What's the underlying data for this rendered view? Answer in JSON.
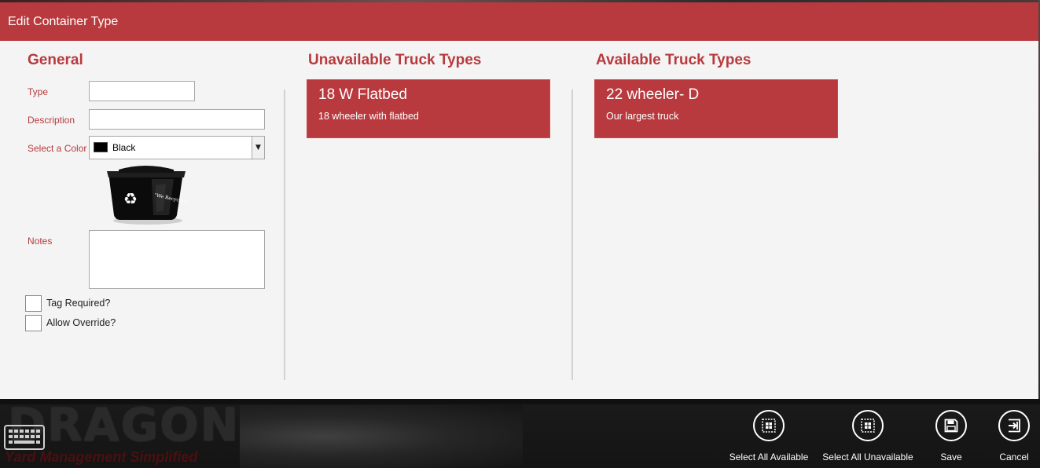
{
  "window": {
    "title": "Edit Container Type"
  },
  "general": {
    "heading": "General",
    "type_label": "Type",
    "type_value": "",
    "description_label": "Description",
    "description_value": "",
    "color_label": "Select a Color",
    "color_value": "Black",
    "color_swatch": "#000000",
    "notes_label": "Notes",
    "notes_value": "",
    "bin_image_text": "\"We Recycle!\"",
    "tag_required_label": "Tag Required?",
    "tag_required_checked": false,
    "allow_override_label": "Allow Override?",
    "allow_override_checked": false
  },
  "unavailable": {
    "heading": "Unavailable Truck Types",
    "items": [
      {
        "name": "18 W Flatbed",
        "description": "18 wheeler with flatbed"
      }
    ]
  },
  "available": {
    "heading": "Available Truck Types",
    "items": [
      {
        "name": "22 wheeler- D",
        "description": "Our largest truck"
      }
    ]
  },
  "appbar": {
    "brand_name": "DRAGON",
    "brand_tagline": "Yard Management Simplified",
    "select_all_available": "Select All Available",
    "select_all_unavailable": "Select All Unavailable",
    "save": "Save",
    "cancel": "Cancel"
  },
  "colors": {
    "accent": "#b83a3e",
    "panel": "#f4f4f4",
    "appbar": "#141414"
  }
}
